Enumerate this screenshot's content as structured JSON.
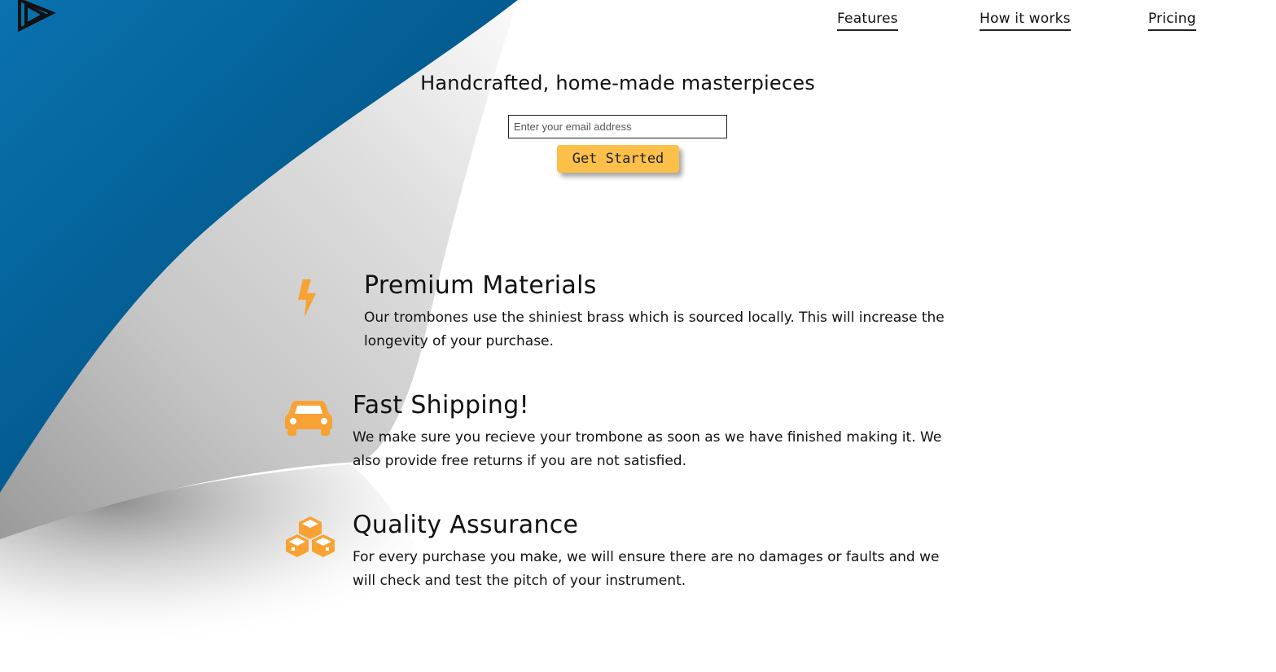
{
  "nav": {
    "items": [
      {
        "label": "Features"
      },
      {
        "label": "How it works"
      },
      {
        "label": "Pricing"
      }
    ]
  },
  "hero": {
    "title": "Handcrafted, home-made masterpieces",
    "email_placeholder": "Enter your email address",
    "email_value": "",
    "cta_label": "Get Started"
  },
  "features": [
    {
      "icon": "lightning-bolt-icon",
      "title": "Premium Materials",
      "text": "Our trombones use the shiniest brass which is sourced locally. This will increase the longevity of your purchase."
    },
    {
      "icon": "car-icon",
      "title": "Fast Shipping!",
      "text": "We make sure you recieve your trombone as soon as we have finished making it. We also provide free returns if you are not satisfied."
    },
    {
      "icon": "cubes-icon",
      "title": "Quality Assurance",
      "text": "For every purchase you make, we will ensure there are no damages or faults and we will check and test the pitch of your instrument."
    }
  ],
  "colors": {
    "accent": "#fcc04a",
    "icon": "#f7a232",
    "blue_dark": "#003a5e",
    "blue_light": "#0a72b0"
  }
}
